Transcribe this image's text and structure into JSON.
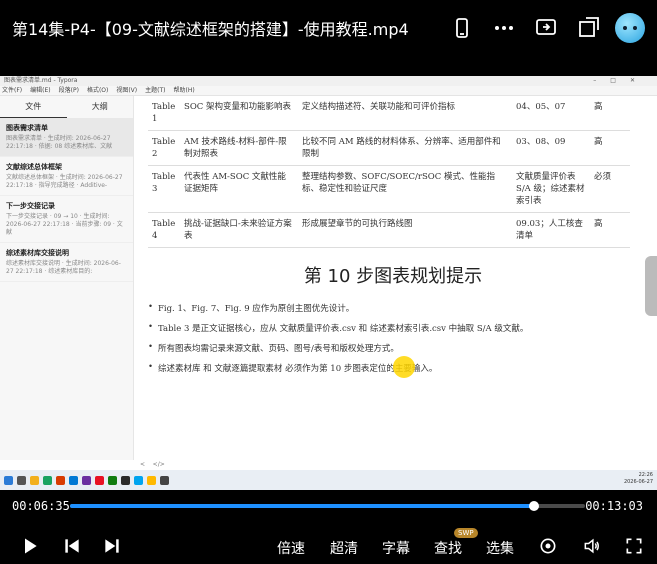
{
  "header": {
    "title": "第14集-P4-【09-文献综述框架的搭建】-使用教程.mp4",
    "icons": [
      "phone-icon",
      "more-icon",
      "cast-icon",
      "window-icon",
      "avatar"
    ]
  },
  "typora": {
    "window_title": "图表需求清单.md - Typora",
    "menu": [
      "文件(F)",
      "编辑(E)",
      "段落(P)",
      "格式(O)",
      "视图(V)",
      "主题(T)",
      "帮助(H)"
    ],
    "sidebar_tabs": [
      "文件",
      "大纲"
    ],
    "files": [
      {
        "name": "图表需求清单",
        "desc": "图表需求清单 · 生成时间: 2026-06-27 22:17:18 · 依据: 08 综述素材库、文献"
      },
      {
        "name": "文献综述总体框架",
        "desc": "文献综述总体框架 · 生成时间: 2026-06-27 22:17:18 · 指导完成路径 · Additive-"
      },
      {
        "name": "下一步交接记录",
        "desc": "下一步交接记录 · 09 → 10 · 生成时间: 2026-06-27 22:17:18 · 当前步骤: 09 · 文献"
      },
      {
        "name": "综述素材库交接说明",
        "desc": "综述素材库交接说明 · 生成时间: 2026-06-27 22:17:18 · 综述素材库目的:"
      }
    ],
    "table_rows": [
      {
        "id": "Table 1",
        "title": "SOC 架构变量和功能影响表",
        "content": "定义结构描述符、关联功能和可评价指标",
        "refs": "04、05、07",
        "priority": "高"
      },
      {
        "id": "Table 2",
        "title": "AM 技术路线-材料-部件-限制对照表",
        "content": "比较不同 AM 路线的材料体系、分辨率、适用部件和限制",
        "refs": "03、08、09",
        "priority": "高"
      },
      {
        "id": "Table 3",
        "title": "代表性 AM-SOC 文献性能证据矩阵",
        "content": "整理结构参数、SOFC/SOEC/rSOC 模式、性能指标、稳定性和验证尺度",
        "refs": "文献质量评价表 S/A 级；综述素材索引表",
        "priority": "必须"
      },
      {
        "id": "Table 4",
        "title": "挑战-证据缺口-未来验证方案表",
        "content": "形成展望章节的可执行路线图",
        "refs": "09.03；人工核查清单",
        "priority": "高"
      }
    ],
    "section_heading": "第 10 步图表规划提示",
    "bullets": [
      "Fig. 1、Fig. 7、Fig. 9 应作为原创主图优先设计。",
      "Table 3 是正文证据核心，应从 文献质量评价表.csv 和 综述素材索引表.csv 中抽取 S/A 级文献。",
      "所有图表均需记录来源文献、页码、图号/表号和版权处理方式。",
      "综述素材库 和 文献逐篇提取素材 必须作为第 10 步图表定位的主要输入。"
    ],
    "status_left": "<",
    "status_code": "</>",
    "taskbar_time": "22:26",
    "taskbar_date": "2026-06-27"
  },
  "player": {
    "current_time": "00:06:35",
    "total_time": "00:13:03",
    "progress_fraction": 0.901,
    "controls": {
      "speed": "倍速",
      "quality": "超清",
      "subtitle": "字幕",
      "search": "查找",
      "search_badge": "SWP",
      "episodes": "选集"
    },
    "accent": "#1e90ff"
  }
}
